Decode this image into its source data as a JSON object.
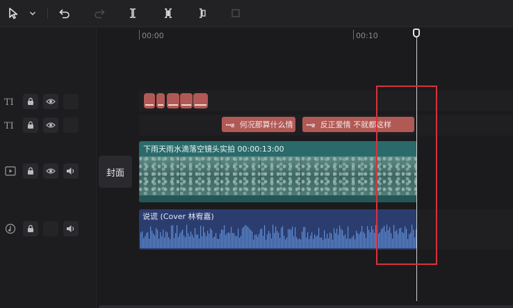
{
  "toolbar": {
    "tools": [
      {
        "name": "select-tool-icon",
        "enabled": true
      },
      {
        "name": "chevron-down-icon",
        "enabled": true
      },
      {
        "name": "undo-icon",
        "enabled": true
      },
      {
        "name": "redo-icon",
        "enabled": false
      },
      {
        "name": "split-icon",
        "enabled": true
      },
      {
        "name": "split-left-icon",
        "enabled": true
      },
      {
        "name": "split-right-icon",
        "enabled": true
      },
      {
        "name": "delete-icon",
        "enabled": false
      }
    ]
  },
  "ruler": {
    "ticks": [
      "00:00",
      "00:10"
    ]
  },
  "tracks": [
    {
      "type": "text",
      "icons": [
        "text-track-icon",
        "lock-icon",
        "eye-icon"
      ]
    },
    {
      "type": "text",
      "icons": [
        "text-track-icon",
        "lock-icon",
        "eye-icon"
      ]
    },
    {
      "type": "video",
      "icons": [
        "video-track-icon",
        "lock-icon",
        "eye-icon",
        "volume-icon"
      ]
    },
    {
      "type": "audio",
      "icons": [
        "audio-track-icon",
        "lock-icon",
        "volume-icon"
      ]
    }
  ],
  "cover_label": "封面",
  "text_clips": [
    {
      "tag": "ꟷƨ",
      "text": "何况那算什么情"
    },
    {
      "tag": "ꟷƨ",
      "text": "反正爱情 不就都这样"
    }
  ],
  "video_clip": {
    "label": "下雨天雨水滴落空镜头实拍  00:00:13:00"
  },
  "audio_clip": {
    "label": "说谎 (Cover 林宥嘉)"
  },
  "colors": {
    "text_clip": "#b15954",
    "video_clip": "#2a6a6a",
    "audio_clip": "#2b3d6e",
    "highlight": "#d8323c"
  }
}
